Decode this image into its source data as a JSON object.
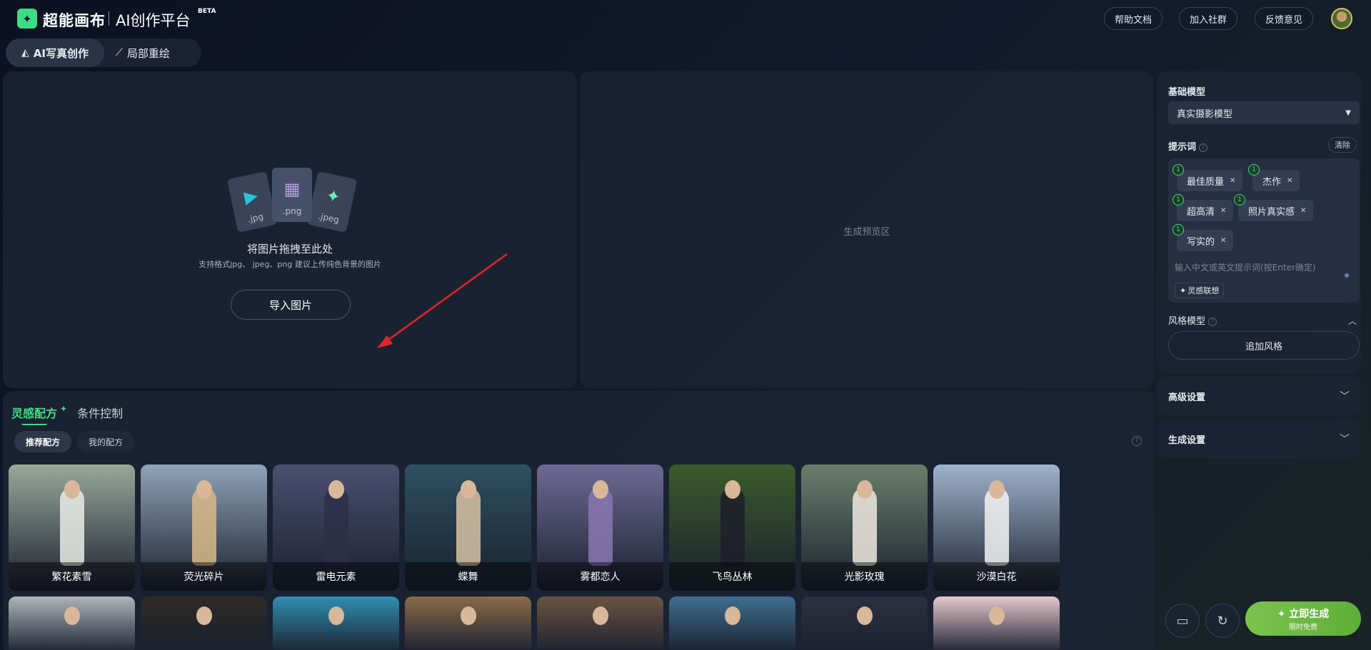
{
  "header": {
    "logo_mark": "✦",
    "brand": "超能画布",
    "platform": "AI创作平台",
    "beta": "BETA",
    "buttons": [
      "帮助文档",
      "加入社群",
      "反馈意见"
    ]
  },
  "mode_tabs": [
    {
      "label": "AI写真创作",
      "icon": "portrait-icon",
      "active": true
    },
    {
      "label": "局部重绘",
      "icon": "magic-wand-icon",
      "active": false
    }
  ],
  "upload": {
    "file_types": [
      ".jpg",
      ".png",
      ".jpeg"
    ],
    "title": "将图片拖拽至此处",
    "subtitle": "支持格式jpg、 jpeg、png 建议上传纯色背景的图片",
    "import_button": "导入图片"
  },
  "preview": {
    "label": "生成预览区"
  },
  "recipes": {
    "tabs": [
      "灵感配方",
      "条件控制"
    ],
    "subtabs": [
      "推荐配方",
      "我的配方"
    ],
    "cards": [
      {
        "label": "繁花素雪",
        "bg": "#9aa79a",
        "dress": "#e9ece6"
      },
      {
        "label": "荧光碎片",
        "bg": "#8fa3b8",
        "dress": "#d7b98a"
      },
      {
        "label": "雷电元素",
        "bg": "#4a4f6f",
        "dress": "#2b3048"
      },
      {
        "label": "蝶舞",
        "bg": "#2d5060",
        "dress": "#d8c2a4"
      },
      {
        "label": "雾都恋人",
        "bg": "#6d6a93",
        "dress": "#8a77b2"
      },
      {
        "label": "飞鸟丛林",
        "bg": "#3b5a2a",
        "dress": "#1d1e2a"
      },
      {
        "label": "光影玫瑰",
        "bg": "#6a7f6c",
        "dress": "#efe9e1"
      },
      {
        "label": "沙漠白花",
        "bg": "#9fb3cc",
        "dress": "#f2f2f2"
      }
    ],
    "cards_row2": [
      {
        "bg": "#aeb4b8"
      },
      {
        "bg": "#2e2a26"
      },
      {
        "bg": "#2f8fb0"
      },
      {
        "bg": "#8a6a4a"
      },
      {
        "bg": "#6a5440"
      },
      {
        "bg": "#3f6e8f"
      },
      {
        "bg": "#2a3140"
      },
      {
        "bg": "#e6c7cd"
      }
    ]
  },
  "sidebar": {
    "base_model_label": "基础模型",
    "base_model_value": "真实摄影模型",
    "prompt_label": "提示词",
    "clear": "清除",
    "chips": [
      {
        "weight": "1",
        "text": "最佳质量"
      },
      {
        "weight": "1",
        "text": "杰作"
      },
      {
        "weight": "1",
        "text": "超高清"
      },
      {
        "weight": "1",
        "text": "照片真实感"
      },
      {
        "weight": "1",
        "text": "写实的"
      }
    ],
    "prompt_placeholder": "输入中文或英文提示词(按Enter确定)",
    "inspiration_button": "灵感联想",
    "style_model_label": "风格模型",
    "add_style": "追加风格",
    "advanced": "高级设置",
    "generation": "生成设置",
    "generate_main": "立即生成",
    "generate_sub": "限时免费"
  },
  "colors": {
    "accent": "#3ddc84",
    "generate": "#6fb843",
    "panel": "#1c2434"
  }
}
